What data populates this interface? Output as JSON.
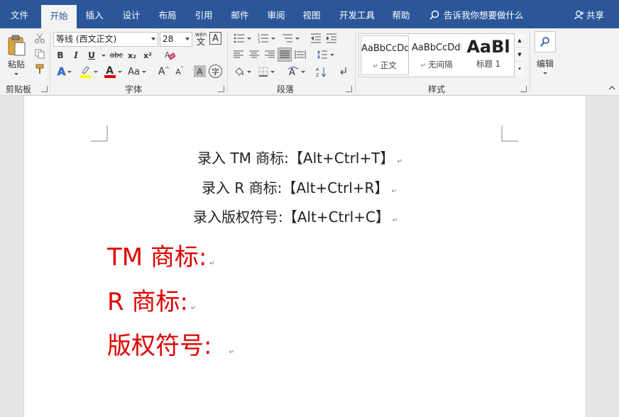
{
  "tabs": [
    {
      "label": "文件",
      "active": false
    },
    {
      "label": "开始",
      "active": true
    },
    {
      "label": "插入",
      "active": false
    },
    {
      "label": "设计",
      "active": false
    },
    {
      "label": "布局",
      "active": false
    },
    {
      "label": "引用",
      "active": false
    },
    {
      "label": "邮件",
      "active": false
    },
    {
      "label": "审阅",
      "active": false
    },
    {
      "label": "视图",
      "active": false
    },
    {
      "label": "开发工具",
      "active": false
    },
    {
      "label": "帮助",
      "active": false
    }
  ],
  "tell_me": "告诉我你想要做什么",
  "share": "共享",
  "ribbon": {
    "clipboard": {
      "paste": "粘贴",
      "group": "剪贴板"
    },
    "font": {
      "font_name": "等线 (西文正文)",
      "font_size": "28",
      "group": "字体",
      "bold": "B",
      "italic": "I",
      "underline": "U",
      "strike": "abc",
      "subscript": "x₂",
      "superscript": "x²",
      "grow": "A",
      "shrink": "A",
      "case": "Aa",
      "phonetic": "wén",
      "highlight_color": "#ffff00",
      "font_color": "#e00000"
    },
    "paragraph": {
      "group": "段落"
    },
    "styles": {
      "group": "样式",
      "items": [
        {
          "preview": "AaBbCcDdI",
          "name": "正文"
        },
        {
          "preview": "AaBbCcDdI",
          "name": "无间隔"
        },
        {
          "preview": "AaBl",
          "name": "标题 1"
        }
      ]
    },
    "editing": {
      "label": "编辑"
    }
  },
  "document": {
    "lines": [
      {
        "text": "录入 TM 商标:【Alt+Ctrl+T】",
        "color": "#222222"
      },
      {
        "text": "录入 R 商标:【Alt+Ctrl+R】",
        "color": "#222222"
      },
      {
        "text": "录入版权符号:【Alt+Ctrl+C】",
        "color": "#222222"
      },
      {
        "text": "TM 商标:",
        "color": "#e00000"
      },
      {
        "text": "R 商标:",
        "color": "#e00000"
      },
      {
        "text": "版权符号:",
        "color": "#e00000"
      }
    ],
    "para_mark": "↵"
  }
}
